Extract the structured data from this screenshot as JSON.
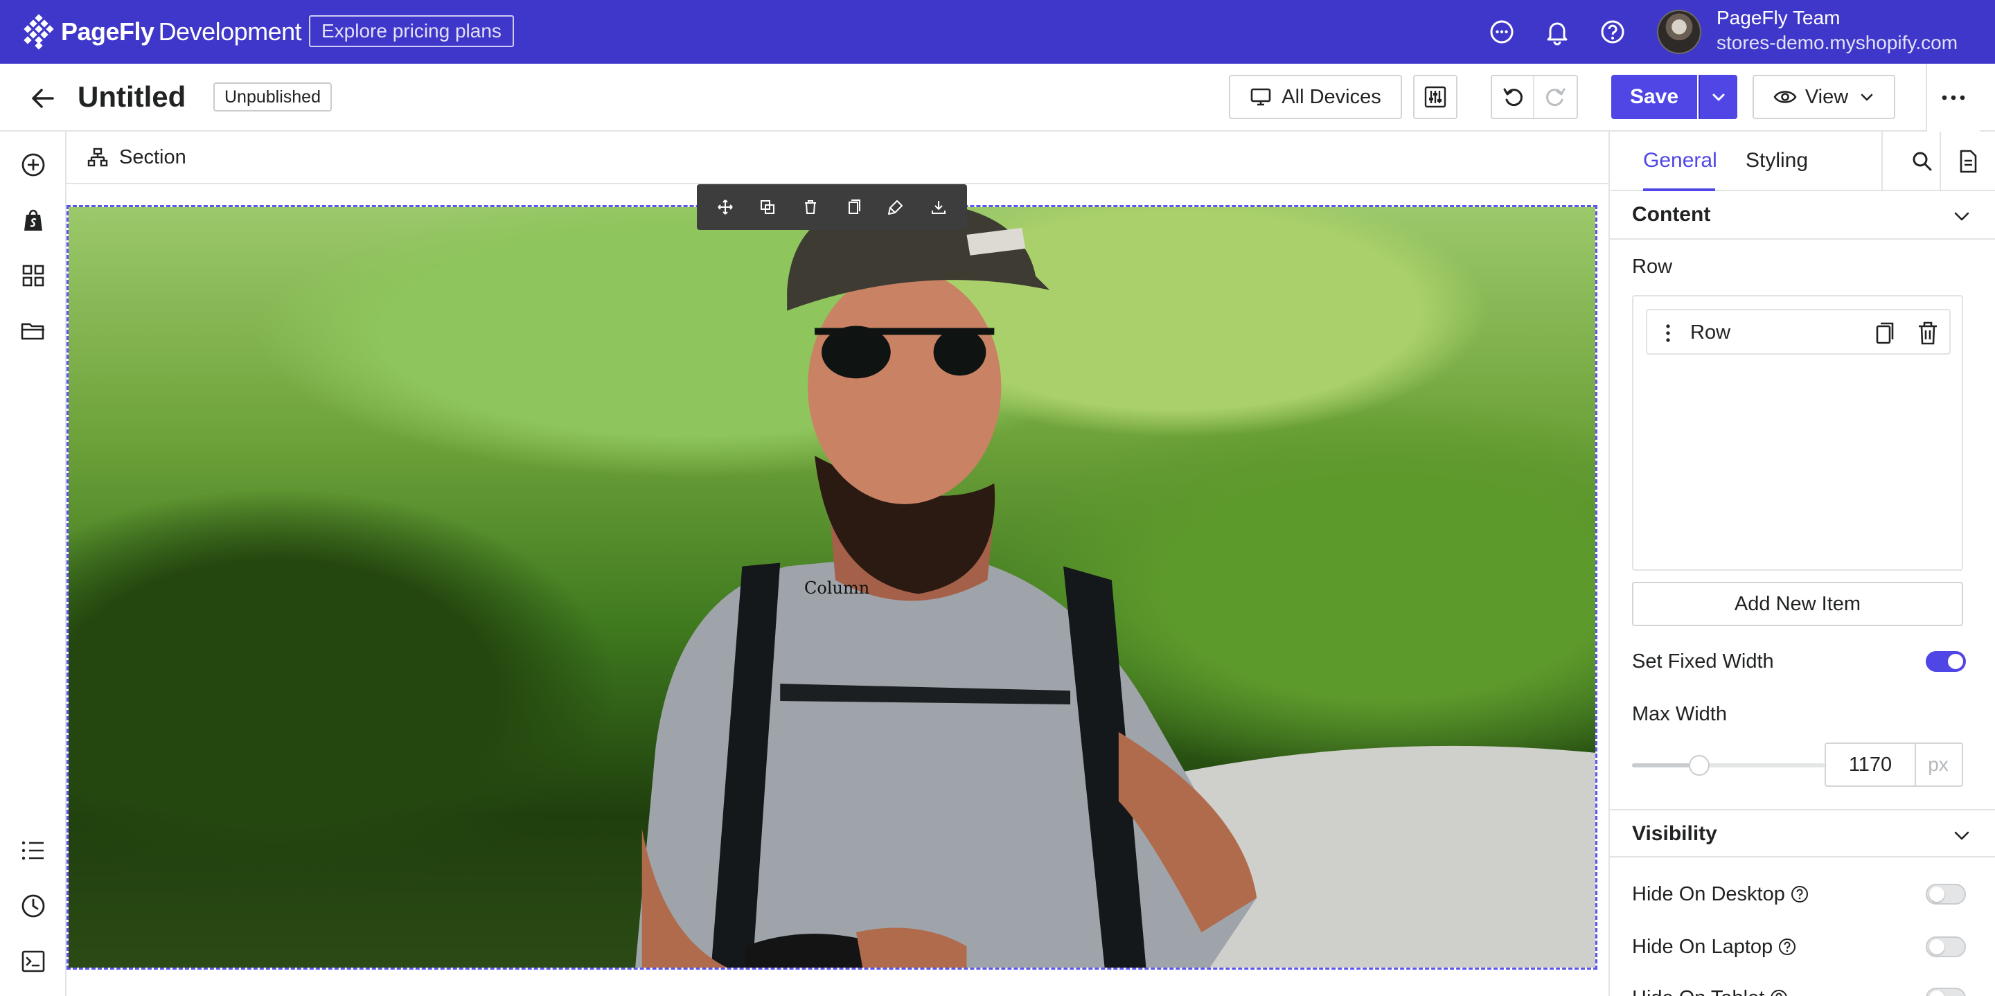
{
  "topbar": {
    "brand_name": "PageFly",
    "brand_suffix": "Development",
    "pricing_label": "Explore pricing plans",
    "account_name": "PageFly Team",
    "store_url": "stores-demo.myshopify.com",
    "icons": [
      "chat-icon",
      "bell-icon",
      "help-icon"
    ],
    "brand_color": "#3f37c9"
  },
  "editbar": {
    "title": "Untitled",
    "status": "Unpublished",
    "devices_label": "All Devices",
    "save_label": "Save",
    "view_label": "View",
    "accent_color": "#4f46e5"
  },
  "leftbar": {
    "icons": [
      "add-icon",
      "shopify-icon",
      "grid-icon",
      "folder-icon",
      "list-icon",
      "history-icon",
      "terminal-icon"
    ]
  },
  "section": {
    "label": "Section"
  },
  "canvas": {
    "column_label": "Column",
    "toolbar_icons": [
      "move-icon",
      "duplicate-icon",
      "delete-icon",
      "copy-icon",
      "paint-icon",
      "download-icon"
    ]
  },
  "panel": {
    "tabs": [
      {
        "label": "General",
        "active": true
      },
      {
        "label": "Styling",
        "active": false
      }
    ],
    "content_title": "Content",
    "row_label": "Row",
    "row_item_label": "Row",
    "add_item_label": "Add New Item",
    "fixed_width_label": "Set Fixed Width",
    "fixed_width_on": true,
    "max_width_label": "Max Width",
    "max_width_value": "1170",
    "max_width_unit": "px",
    "visibility_title": "Visibility",
    "hide_desktop_label": "Hide On Desktop",
    "hide_laptop_label": "Hide On Laptop",
    "hide_tablet_label": "Hide On Tablet"
  }
}
